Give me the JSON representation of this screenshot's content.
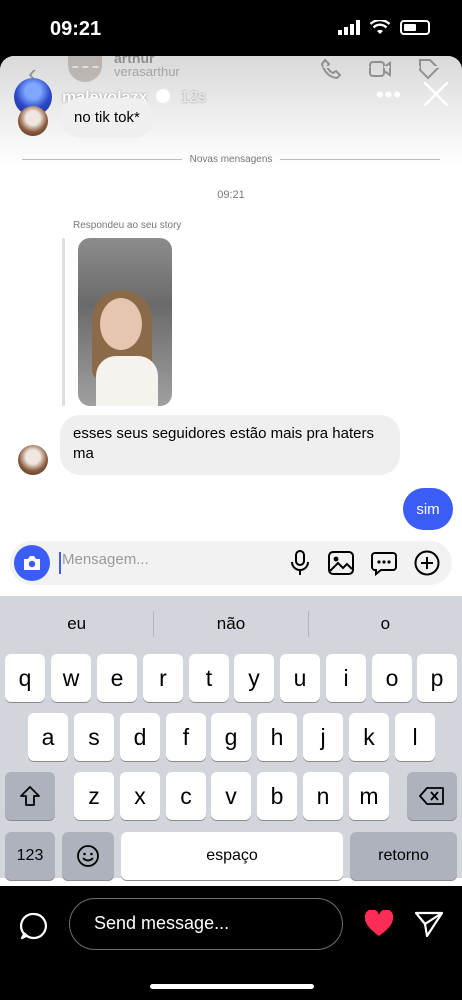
{
  "status_bar": {
    "time": "09:21"
  },
  "chat_header": {
    "name": "arthur",
    "handle": "verasarthur"
  },
  "story": {
    "username": "malevolazx",
    "age": "12s"
  },
  "messages": {
    "incoming_1": "no tik tok*",
    "divider_label": "Novas mensagens",
    "timestamp": "09:21",
    "replied_label": "Respondeu ao seu story",
    "incoming_2": "esses seus seguidores estão mais pra haters ma",
    "outgoing_1": "sim"
  },
  "composer": {
    "placeholder": "Mensagem..."
  },
  "keyboard": {
    "suggestions": [
      "eu",
      "não",
      "o"
    ],
    "row1": [
      "q",
      "w",
      "e",
      "r",
      "t",
      "y",
      "u",
      "i",
      "o",
      "p"
    ],
    "row2": [
      "a",
      "s",
      "d",
      "f",
      "g",
      "h",
      "j",
      "k",
      "l"
    ],
    "row3": [
      "z",
      "x",
      "c",
      "v",
      "b",
      "n",
      "m"
    ],
    "numbers_key": "123",
    "space_key": "espaço",
    "return_key": "retorno"
  },
  "bottom_bar": {
    "send_placeholder": "Send message..."
  },
  "colors": {
    "accent": "#3a5df6",
    "heart": "#ff2d55"
  },
  "icons": [
    "signal-icon",
    "wifi-icon",
    "battery-icon",
    "back-icon",
    "phone-icon",
    "video-icon",
    "tag-icon",
    "verified-icon",
    "more-icon",
    "close-icon",
    "camera-icon",
    "mic-icon",
    "image-icon",
    "sticker-icon",
    "plus-icon",
    "shift-icon",
    "backspace-icon",
    "emoji-icon",
    "chat-bubble-icon",
    "heart-icon",
    "send-icon"
  ]
}
